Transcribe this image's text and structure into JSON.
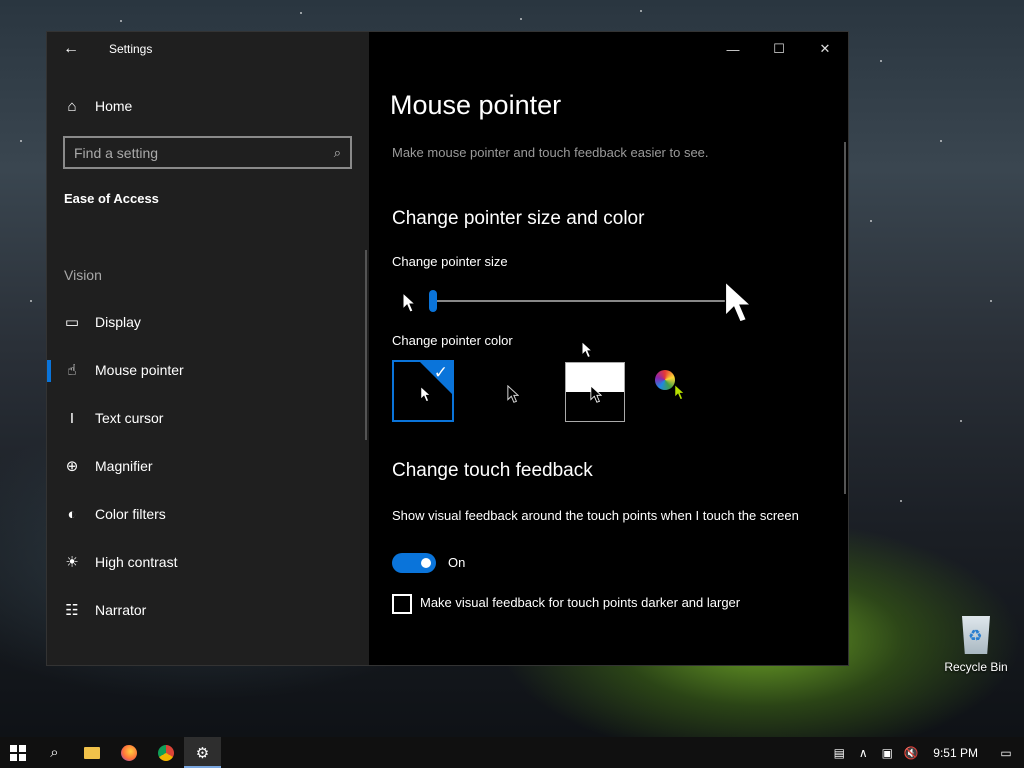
{
  "window": {
    "app_title": "Settings",
    "controls": {
      "minimize": "—",
      "maximize": "☐",
      "close": "✕"
    }
  },
  "sidebar": {
    "home_label": "Home",
    "search_placeholder": "Find a setting",
    "section_title": "Ease of Access",
    "group_title": "Vision",
    "items": [
      {
        "label": "Display",
        "icon": "display-icon",
        "selected": false
      },
      {
        "label": "Mouse pointer",
        "icon": "mouse-pointer-icon",
        "selected": true
      },
      {
        "label": "Text cursor",
        "icon": "text-cursor-icon",
        "selected": false
      },
      {
        "label": "Magnifier",
        "icon": "magnifier-icon",
        "selected": false
      },
      {
        "label": "Color filters",
        "icon": "color-filters-icon",
        "selected": false
      },
      {
        "label": "High contrast",
        "icon": "high-contrast-icon",
        "selected": false
      },
      {
        "label": "Narrator",
        "icon": "narrator-icon",
        "selected": false
      }
    ]
  },
  "main": {
    "page_title": "Mouse pointer",
    "page_description": "Make mouse pointer and touch feedback easier to see.",
    "size_color_heading": "Change pointer size and color",
    "pointer_size_label": "Change pointer size",
    "pointer_size_value": 1,
    "pointer_size_max": 15,
    "pointer_color_label": "Change pointer color",
    "pointer_color_options": [
      {
        "name": "white",
        "selected": true
      },
      {
        "name": "black",
        "selected": false
      },
      {
        "name": "inverted",
        "selected": false
      },
      {
        "name": "custom",
        "selected": false
      }
    ],
    "touch_heading": "Change touch feedback",
    "touch_feedback_label": "Show visual feedback around the touch points when I touch the screen",
    "touch_toggle_state": "On",
    "touch_darker_label": "Make visual feedback for touch points darker and larger",
    "touch_darker_checked": false
  },
  "desktop": {
    "recycle_bin_label": "Recycle Bin"
  },
  "taskbar": {
    "apps": [
      "start-icon",
      "search-icon",
      "file-explorer-icon",
      "firefox-icon",
      "chrome-icon",
      "settings-icon"
    ],
    "active_app": "settings-icon",
    "clock": "9:51 PM"
  },
  "colors": {
    "accent": "#0a74da",
    "sidebar_bg": "#1f1f1f",
    "main_bg": "#000000",
    "taskbar_bg": "#101010"
  }
}
